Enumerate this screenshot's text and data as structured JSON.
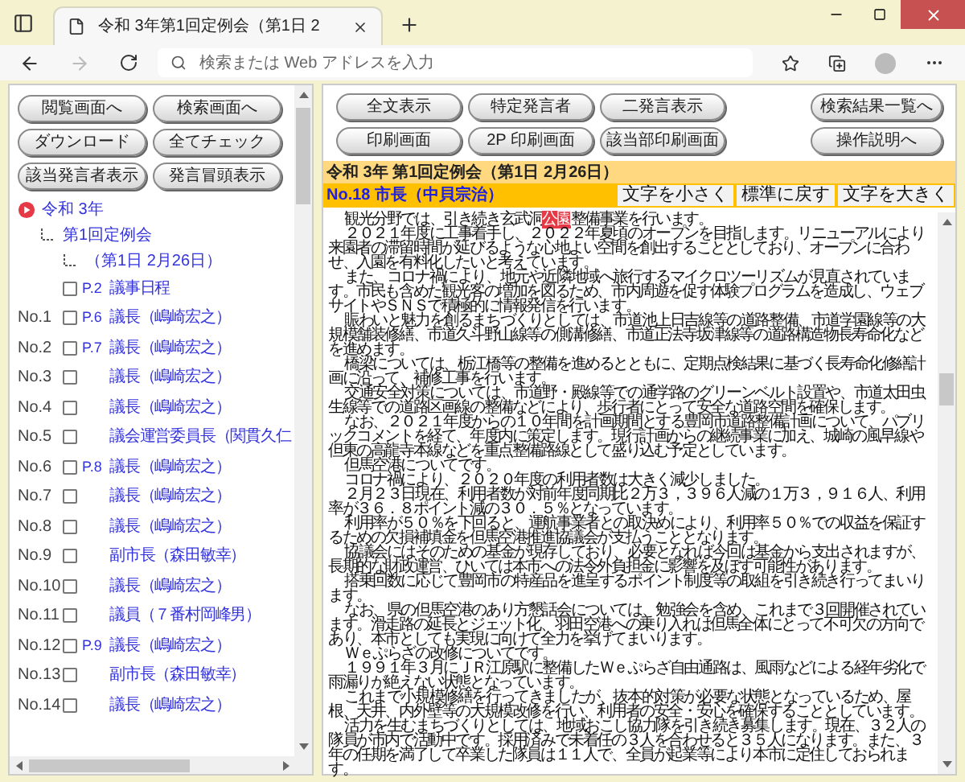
{
  "browser": {
    "tab_title": "令和 3年第1回定例会（第1日 2",
    "address_placeholder": "検索または Web アドレスを入力",
    "forward_disabled": true
  },
  "left_panel": {
    "button_rows": [
      [
        "閲覧画面へ",
        "検索画面へ"
      ],
      [
        "ダウンロード",
        "全てチェック"
      ],
      [
        "該当発言者表示",
        "発言冒頭表示"
      ]
    ],
    "tree": [
      {
        "label": "令和 3年",
        "children": [
          {
            "label": "第1回定例会",
            "children": [
              {
                "label": "（第1日 2月26日）"
              }
            ]
          }
        ]
      }
    ],
    "items": [
      {
        "checked": false,
        "page": "P.2",
        "speaker": "議事日程"
      },
      {
        "no": "No.1",
        "checked": false,
        "page": "P.6",
        "speaker": "議長（嶋崎宏之）"
      },
      {
        "no": "No.2",
        "checked": false,
        "page": "P.7",
        "speaker": "議長（嶋崎宏之）"
      },
      {
        "no": "No.3",
        "checked": false,
        "speaker": "議長（嶋崎宏之）"
      },
      {
        "no": "No.4",
        "checked": false,
        "speaker": "議長（嶋崎宏之）"
      },
      {
        "no": "No.5",
        "checked": false,
        "speaker": "議会運営委員長（関貫久仁"
      },
      {
        "no": "No.6",
        "checked": false,
        "page": "P.8",
        "speaker": "議長（嶋崎宏之）"
      },
      {
        "no": "No.7",
        "checked": false,
        "speaker": "議長（嶋崎宏之）"
      },
      {
        "no": "No.8",
        "checked": false,
        "speaker": "議長（嶋崎宏之）"
      },
      {
        "no": "No.9",
        "checked": false,
        "speaker": "副市長（森田敏幸）"
      },
      {
        "no": "No.10",
        "checked": false,
        "speaker": "議長（嶋崎宏之）"
      },
      {
        "no": "No.11",
        "checked": false,
        "speaker": "議員（７番村岡峰男）"
      },
      {
        "no": "No.12",
        "checked": false,
        "page": "P.9",
        "speaker": "議長（嶋崎宏之）"
      },
      {
        "no": "No.13",
        "checked": false,
        "speaker": "副市長（森田敏幸）"
      },
      {
        "no": "No.14",
        "checked": false,
        "speaker": "議長（嶋崎宏之）"
      }
    ]
  },
  "main": {
    "button_rows": [
      [
        "全文表示",
        "特定発言者",
        "二発言表示"
      ],
      [
        "印刷画面",
        "2P 印刷画面",
        "該当部印刷画面"
      ]
    ],
    "side_buttons": [
      "検索結果一覧へ",
      "操作説明へ"
    ],
    "meeting_title": "令和 3年 第1回定例会（第1日 2月26日）",
    "speaker": "No.18 市長（中貝宗治）",
    "font_buttons": [
      "文字を小さく",
      "標準に戻す",
      "文字を大きく"
    ],
    "paragraphs": [
      {
        "segments": [
          {
            "text": "観光分野では、引き続き玄武洞",
            "highlighted": false
          },
          {
            "text": "公園",
            "highlighted": true
          },
          {
            "text": "整備事業を行います。",
            "highlighted": false
          }
        ]
      },
      {
        "segments": [
          {
            "text": "２０２１年度に工事着手し、２０２２年夏頃のオープンを目指します。リニューアルにより来園者の滞留時間が延びるような心地よい空間を創出することとしており、オープンに合わせ、入園を有料化したいと考えています。",
            "highlighted": false
          }
        ]
      },
      {
        "segments": [
          {
            "text": "また、コロナ禍により、地元や近隣地域へ旅行するマイクロツーリズムが見直されています。市民も含めた観光客の増加を図るため、市内周遊を促す体験プログラムを造成し、ウェブサイトやＳＮＳで積極的に情報発信を行います。",
            "highlighted": false
          }
        ]
      },
      {
        "segments": [
          {
            "text": "賑わいと魅力を創るまちづくりとしては、市道池上日吉線等の道路整備、市道学園線等の大規模舗装修繕、市道久斗野山線等の側溝修繕、市道正法寺坂津線等の道路構造物長寿命化などを進めます。",
            "highlighted": false
          }
        ]
      },
      {
        "segments": [
          {
            "text": "橋梁については、栃江橋等の整備を進めるとともに、定期点検結果に基づく長寿命化修繕計画に沿って、補修工事を行います。",
            "highlighted": false
          }
        ]
      },
      {
        "segments": [
          {
            "text": "交通安全対策については、市道野・殿線等での通学路のグリーンベルト設置や、市道太田虫生線等での道路区画線の整備などにより、歩行者にとって安全な道路空間を確保します。",
            "highlighted": false
          }
        ]
      },
      {
        "segments": [
          {
            "text": "なお、２０２１年度からの１０年間を計画期間とする豊岡市道路整備計画について、パブリックコメントを経て、年度内に策定します。現行計画からの継続事業に加え、城崎の風早線や但東の高龍寺本線などを重点整備路線として盛り込む予定としています。",
            "highlighted": false
          }
        ]
      },
      {
        "segments": [
          {
            "text": "但馬空港についてです。",
            "highlighted": false
          }
        ]
      },
      {
        "segments": [
          {
            "text": "コロナ禍により、２０２０年度の利用者数は大きく減少しました。",
            "highlighted": false
          }
        ]
      },
      {
        "segments": [
          {
            "text": "２月２３日現在、利用者数が対前年度同期比２万３，３９６人減の１万３，９１６人、利用率が３６．８ポイント減の３０．５％となっています。",
            "highlighted": false
          }
        ]
      },
      {
        "segments": [
          {
            "text": "利用率が５０％を下回ると、運航事業者との取決めにより、利用率５０％での収益を保証するための欠損補填金を但馬空港推進協議会が支払うこととなります。",
            "highlighted": false
          }
        ]
      },
      {
        "segments": [
          {
            "text": "協議会にはそのための基金が現存しており、必要となれば今回は基金から支出されますが、長期的な財政運営、ひいては本市への法令外負担金に影響を及ぼす可能性があります。",
            "highlighted": false
          }
        ]
      },
      {
        "segments": [
          {
            "text": "搭乗回数に応じて豊岡市の特産品を進呈するポイント制度等の取組を引き続き行ってまいります。",
            "highlighted": false
          }
        ]
      },
      {
        "segments": [
          {
            "text": "なお、県の但馬空港のあり方懇話会については、勉強会を含め、これまで３回開催されています。滑走路の延長とジェット化、羽田空港への乗り入れは但馬全体にとって不可欠の方向であり、本市としても実現に向けて全力を挙げてまいります。",
            "highlighted": false
          }
        ]
      },
      {
        "segments": [
          {
            "text": "Ｗｅぷらざの改修についてです。",
            "highlighted": false
          }
        ]
      },
      {
        "segments": [
          {
            "text": "１９９１年３月にＪＲ江原駅に整備したＷｅぷらざ自由通路は、風雨などによる経年劣化で雨漏りが絶えない状態となっています。",
            "highlighted": false
          }
        ]
      },
      {
        "segments": [
          {
            "text": "これまで小規模修繕を行ってきましたが、抜本的対策が必要な状態となっているため、屋根、天井、内外壁等の大規模改修を行い、利用者の安全・安心を確保することとしています。",
            "highlighted": false
          }
        ]
      },
      {
        "segments": [
          {
            "text": "活力を生むまちづくりとしては、地域おこし協力隊を引き続き募集します。現在、３２人の隊員が市内で活動中です。採用済みで未着任の３人を合わせると３５人になります。また、３年の任期を満了して卒業した隊員は１１人で、全員が起業等により本市に定住しておられます。",
            "highlighted": false
          }
        ]
      }
    ]
  }
}
